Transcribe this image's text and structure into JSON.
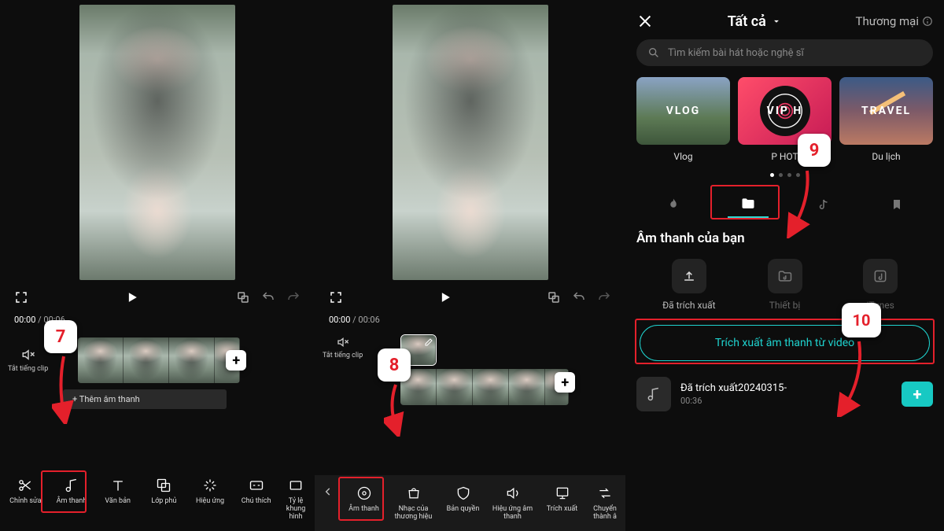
{
  "panel1": {
    "time_now": "00:00",
    "time_total": "00:06",
    "mute_label": "Tắt tiếng clip",
    "add_audio_label": "Thêm âm thanh",
    "badge": "7",
    "toolbar": [
      {
        "label": "Chỉnh sửa"
      },
      {
        "label": "Âm thanh"
      },
      {
        "label": "Văn bản"
      },
      {
        "label": "Lớp phủ"
      },
      {
        "label": "Hiệu ứng"
      },
      {
        "label": "Chú thích"
      },
      {
        "label": "Tỷ lệ khung hình"
      }
    ]
  },
  "panel2": {
    "time_now": "00:00",
    "time_total": "00:06",
    "mute_label": "Tắt tiếng clip",
    "badge": "8",
    "toolbar": [
      {
        "label": "Âm thanh"
      },
      {
        "label": "Nhạc của thương hiệu"
      },
      {
        "label": "Bản quyền"
      },
      {
        "label": "Hiệu ứng âm thanh"
      },
      {
        "label": "Trích xuất"
      },
      {
        "label": "Chuyển thành â"
      }
    ]
  },
  "panel3": {
    "title": "Tất cả",
    "commercial": "Thương mại",
    "search_placeholder": "Tìm kiếm bài hát hoặc nghệ sĩ",
    "badge9": "9",
    "badge10": "10",
    "categories": [
      {
        "img": "VLOG",
        "label": "Vlog"
      },
      {
        "img": "VIP H",
        "label": "P HOT"
      },
      {
        "img": "TRAVEL",
        "label": "Du lịch"
      }
    ],
    "section_title": "Âm thanh của bạn",
    "sources": [
      {
        "label": "Đã trích xuất"
      },
      {
        "label": "Thiết bị"
      },
      {
        "label": "iTunes"
      }
    ],
    "extract_button": "Trích xuất âm thanh từ video",
    "extracted": {
      "title": "Đã trích xuất20240315-",
      "duration": "00:36"
    }
  }
}
